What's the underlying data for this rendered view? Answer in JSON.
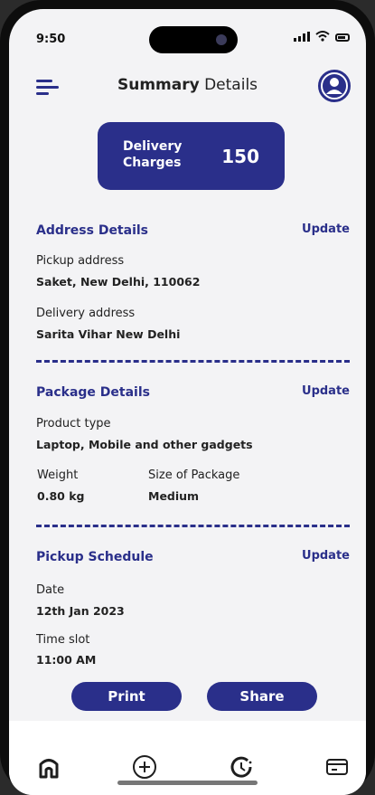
{
  "status": {
    "time": "9:50"
  },
  "header": {
    "title_bold": "Summary",
    "title_rest": "Details"
  },
  "charges": {
    "label": "Delivery Charges",
    "value": "150"
  },
  "address": {
    "title": "Address Details",
    "update": "Update",
    "pickup_label": "Pickup address",
    "pickup_value": "Saket, New Delhi, 110062",
    "delivery_label": "Delivery address",
    "delivery_value": "Sarita Vihar  New Delhi"
  },
  "package": {
    "title": "Package Details",
    "update": "Update",
    "product_label": "Product type",
    "product_value": "Laptop, Mobile and other gadgets",
    "weight_label": "Weight",
    "weight_value": "0.80 kg",
    "size_label": "Size of Package",
    "size_value": "Medium"
  },
  "schedule": {
    "title": "Pickup Schedule",
    "update": "Update",
    "date_label": "Date",
    "date_value": "12th Jan 2023",
    "slot_label": "Time slot",
    "slot_value": "11:00 AM"
  },
  "actions": {
    "print": "Print",
    "share": "Share"
  },
  "tabs": [
    "home-icon",
    "add-icon",
    "history-icon",
    "card-icon"
  ],
  "colors": {
    "accent": "#2a2f8a",
    "background": "#f3f3f5"
  }
}
